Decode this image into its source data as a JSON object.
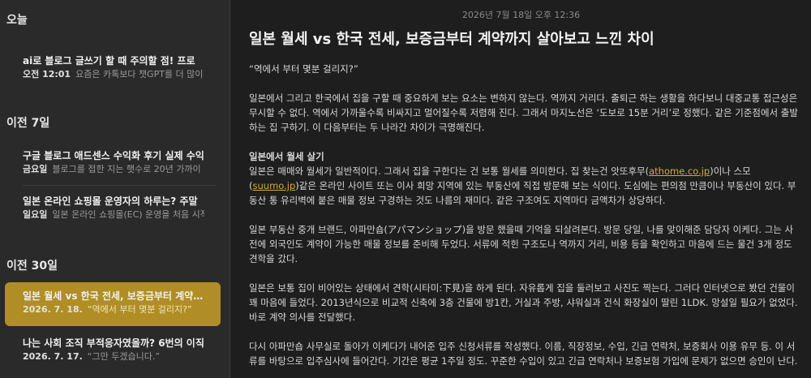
{
  "sidebar": {
    "sections": [
      {
        "label": "오늘"
      },
      {
        "label": "이전 7일"
      },
      {
        "label": "이전 30일"
      }
    ],
    "notes": [
      {
        "title": "ai로 블로그 글쓰기 할 때 주의할 점! 프로",
        "date": "오전 12:01",
        "preview": "요즘은 카톡보다 챗GPT를 더 많이"
      },
      {
        "title": "구글 블로그 애드센스 수익화 후기 실제 수익",
        "date": "금요일",
        "preview": "블로그를 접한 지는 햇수로 20년 가까이"
      },
      {
        "title": "일본 온라인 쇼핑몰 운영자의 하루는? 주말",
        "date": "일요일",
        "preview": "일본 온라인 쇼핑몰(EC) 운영을 처음 시작"
      },
      {
        "title": "일본 월세 vs 한국 전세, 보증금부터 계약까지",
        "date": "2026. 7. 18.",
        "preview": "“역에서 부터 몇분 걸리지?”"
      },
      {
        "title": "나는 사회 조직 부적응자였을까? 6번의 이직",
        "date": "2026. 7. 17.",
        "preview": "“그만 두겠습니다.”"
      }
    ]
  },
  "content": {
    "timestamp": "2026년 7월 18일 오후 12:36",
    "heading": "일본 월세 vs 한국 전세, 보증금부터 계약까지 살아보고 느낀 차이",
    "p1": "“역에서 부터 몇분 걸리지?”",
    "p2": "일본에서 그리고 한국에서 집을 구할 때 중요하게 보는 요소는 변하지 않는다. 역까지 거리다. 출퇴근 하는 생활을 하다보니 대중교통 접근성은 무시할 수 없다. 역에서 가까울수록 비싸지고 멀어질수록 저렴해 진다. 그래서 마지노선은 ‘도보로 15분 거리’로 정했다. 같은 기준점에서 출발하는 집 구하기. 이 다음부터는 두 나라간 차이가 극명해진다.",
    "p3_heading": "일본에서 월세 살기",
    "p3_a": "일본은 매매와 월세가 일반적이다. 그래서 집을 구한다는 건 보통 월세를 의미한다. 집 찾는건 앗또후무(",
    "p3_link1": "athome.co.jp",
    "p3_b": ")이나 스모(",
    "p3_link2": "suumo.jp",
    "p3_c": ")같은 온라인 사이트 또는 이사 희망 지역에 있는 부동산에 직접 방문해 보는 식이다. 도심에는 편의점 만큼이나 부동산이 있다. 부동산 통 유리벽에 붙은 매물 정보 구경하는 것도 나름의 재미다. 같은 구조여도 지역마다 금액차가 상당하다.",
    "p4": "일본 부동산 중개 브랜드, 아파만숍(アパマンショップ)을 방문 했을때 기억을 되살려본다. 방문 당일, 나를 맞이해준 담당자 이케다. 그는 사전에 외국인도 계약이 가능한 매물 정보를 준비해 두었다. 서류에 적힌 구조도나 역까지 거리, 비용 등을 확인하고 마음에 드는 물건 3개 정도 견학을 갔다.",
    "p5": "일본은 보통 집이 비어있는 상태에서 견학(시타미:下見)을 하게 된다. 자유롭게 집을 둘러보고 사진도 찍는다. 그러다 인터넷으로 봤던 건물이 꽤 마음에 들었다. 2013년식으로 비교적 신축에 3층 건물에 방1칸, 거실과 주방, 샤워실과 건식 화장실이 딸린 1LDK. 망설일 필요가 없었다. 바로 계약 의사를 전달했다.",
    "p6": "다시 아파만숍 사무실로 돌아가 이케다가 내어준 입주 신청서류를 작성했다. 이름, 직장정보, 수입, 긴급 연락처, 보증회사 이용 유무 등. 이 서류를 바탕으로 입주심사에 들어간다. 기간은 평균 1주일 정도. 꾸준한 수입이 있고 긴급 연락처나 보증보험 가입에 문제가 없으면 승인이 난다."
  }
}
